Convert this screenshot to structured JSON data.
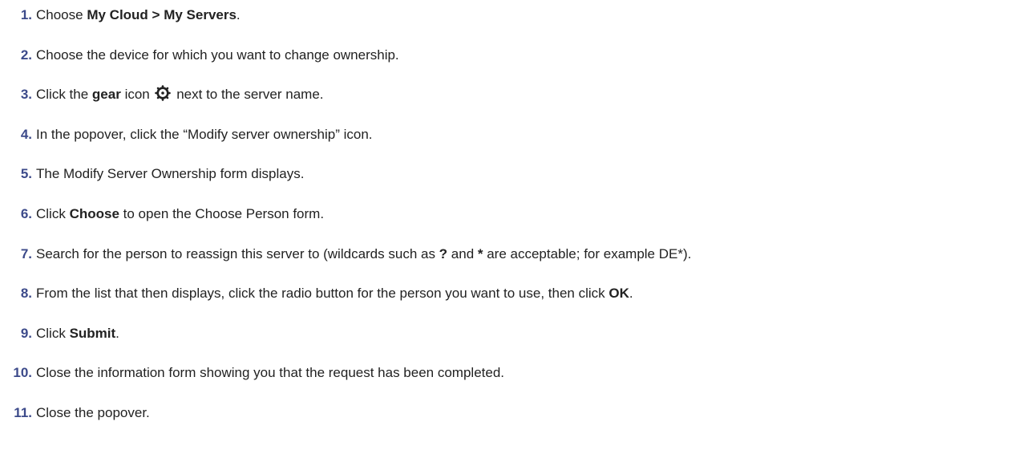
{
  "steps": [
    {
      "num": "1.",
      "parts": [
        {
          "t": "Choose "
        },
        {
          "t": "My Cloud > My Servers",
          "b": true
        },
        {
          "t": "."
        }
      ]
    },
    {
      "num": "2.",
      "parts": [
        {
          "t": "Choose the device for which you want to change ownership."
        }
      ]
    },
    {
      "num": "3.",
      "parts": [
        {
          "t": "Click the "
        },
        {
          "t": "gear",
          "b": true
        },
        {
          "t": " icon "
        },
        {
          "icon": "gear-icon"
        },
        {
          "t": " next to the server name."
        }
      ]
    },
    {
      "num": "4.",
      "parts": [
        {
          "t": "In the popover, click the “Modify server ownership” icon."
        }
      ]
    },
    {
      "num": "5.",
      "parts": [
        {
          "t": "The Modify Server Ownership form displays."
        }
      ]
    },
    {
      "num": "6.",
      "parts": [
        {
          "t": "Click "
        },
        {
          "t": "Choose",
          "b": true
        },
        {
          "t": " to open the Choose Person form."
        }
      ]
    },
    {
      "num": "7.",
      "parts": [
        {
          "t": "Search for the person to reassign this server to (wildcards such as "
        },
        {
          "t": "?",
          "b": true
        },
        {
          "t": " and "
        },
        {
          "t": "*",
          "b": true
        },
        {
          "t": " are acceptable; for example DE*)."
        }
      ]
    },
    {
      "num": "8.",
      "parts": [
        {
          "t": "From the list that then displays, click the radio button for the person you want to use, then click "
        },
        {
          "t": "OK",
          "b": true
        },
        {
          "t": "."
        }
      ]
    },
    {
      "num": "9.",
      "parts": [
        {
          "t": "Click "
        },
        {
          "t": "Submit",
          "b": true
        },
        {
          "t": "."
        }
      ]
    },
    {
      "num": "10.",
      "parts": [
        {
          "t": "Close the information form showing you that the request has been completed."
        }
      ]
    },
    {
      "num": "11.",
      "parts": [
        {
          "t": "Close the popover."
        }
      ]
    }
  ],
  "colors": {
    "number": "#3c4a8a",
    "text": "#222222",
    "background": "#ffffff"
  }
}
